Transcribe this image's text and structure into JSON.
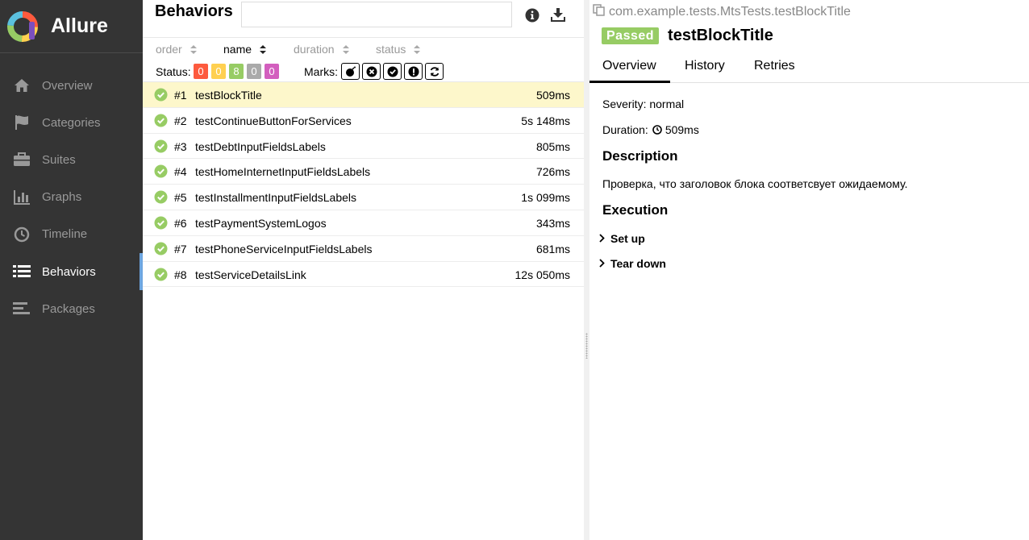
{
  "app": {
    "name": "Allure"
  },
  "sidebar": {
    "items": [
      {
        "label": "Overview",
        "icon": "home-icon"
      },
      {
        "label": "Categories",
        "icon": "flag-icon"
      },
      {
        "label": "Suites",
        "icon": "briefcase-icon"
      },
      {
        "label": "Graphs",
        "icon": "bar-chart-icon"
      },
      {
        "label": "Timeline",
        "icon": "clock-icon"
      },
      {
        "label": "Behaviors",
        "icon": "list-icon",
        "active": true
      },
      {
        "label": "Packages",
        "icon": "align-left-icon"
      }
    ]
  },
  "behaviors": {
    "title": "Behaviors",
    "search_value": "",
    "sort": {
      "order": "order",
      "name": "name",
      "duration": "duration",
      "status": "status",
      "active": "name"
    },
    "status_label": "Status:",
    "status_counts": [
      {
        "value": "0",
        "color": "#fd5a3e"
      },
      {
        "value": "0",
        "color": "#ffd050"
      },
      {
        "value": "8",
        "color": "#97cc64"
      },
      {
        "value": "0",
        "color": "#aaaaaa"
      },
      {
        "value": "0",
        "color": "#d35ebe"
      }
    ],
    "marks_label": "Marks:",
    "marks": [
      "bomb-icon",
      "times-circle-icon",
      "check-circle-icon",
      "exclamation-circle-icon",
      "refresh-icon"
    ],
    "tests": [
      {
        "num": "#1",
        "name": "testBlockTitle",
        "duration": "509ms",
        "selected": true
      },
      {
        "num": "#2",
        "name": "testContinueButtonForServices",
        "duration": "5s 148ms"
      },
      {
        "num": "#3",
        "name": "testDebtInputFieldsLabels",
        "duration": "805ms"
      },
      {
        "num": "#4",
        "name": "testHomeInternetInputFieldsLabels",
        "duration": "726ms"
      },
      {
        "num": "#5",
        "name": "testInstallmentInputFieldsLabels",
        "duration": "1s 099ms"
      },
      {
        "num": "#6",
        "name": "testPaymentSystemLogos",
        "duration": "343ms"
      },
      {
        "num": "#7",
        "name": "testPhoneServiceInputFieldsLabels",
        "duration": "681ms"
      },
      {
        "num": "#8",
        "name": "testServiceDetailsLink",
        "duration": "12s 050ms"
      }
    ]
  },
  "detail": {
    "full_name": "com.example.tests.MtsTests.testBlockTitle",
    "status": "Passed",
    "name": "testBlockTitle",
    "tabs": [
      "Overview",
      "History",
      "Retries"
    ],
    "severity": "Severity: normal",
    "duration_label": "Duration:",
    "duration_value": "509ms",
    "description_title": "Description",
    "description": "Проверка, что заголовок блока соответсвует ожидаемому.",
    "execution_title": "Execution",
    "steps": [
      "Set up",
      "Tear down"
    ]
  },
  "colors": {
    "passed": "#97cc64",
    "sidebar": "#343434",
    "accent": "#6ea6e0",
    "selected_row": "#fdf7cb"
  }
}
